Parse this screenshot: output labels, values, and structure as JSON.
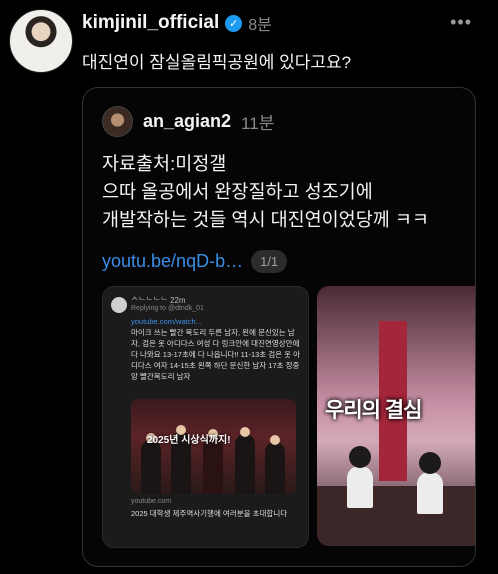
{
  "post": {
    "username": "kimjinil_official",
    "verified_icon": "verified-badge-icon",
    "time": "8분",
    "more_icon": "more-dots-icon",
    "text": "대진연이 잠실올림픽공원에 있다고요?"
  },
  "quote": {
    "username": "an_agian2",
    "time": "11분",
    "text": "자료출처:미정갤\n으따 올공에서 완장질하고 성조기에\n개발작하는 것들 역시 대진연이었당께 ㅋㅋ",
    "link": "youtu.be/nqD-b…",
    "page_indicator": "1/1",
    "media": [
      {
        "kind": "screenshot-of-post",
        "user": "ᄉᄂᄂᄂᄂ 22m",
        "reply_to": "Replying to @dtndk_01",
        "link": "youtube.com/watch...",
        "text": "마이크 쓰는 빨간 목도리 두른 남자, 왼에 문신있는 남자, 검은 옷 아디다스 여성 다 링크안에 대진연영상안에 다 나와요\n13-17초에 다 나옵니다!!\n11-13초 검은 옷 아디다스 여자 14-15초 왼쪽 하단 문신한 남자 17초 정중앙 빨간목도리 남자",
        "photo_caption": "2025년 시상식까지!",
        "source": "youtube.com",
        "title": "2025 대학생 제주역사기행에 여러분을 초대합니다"
      },
      {
        "kind": "video-frame",
        "caption": "우리의 결심"
      }
    ]
  }
}
